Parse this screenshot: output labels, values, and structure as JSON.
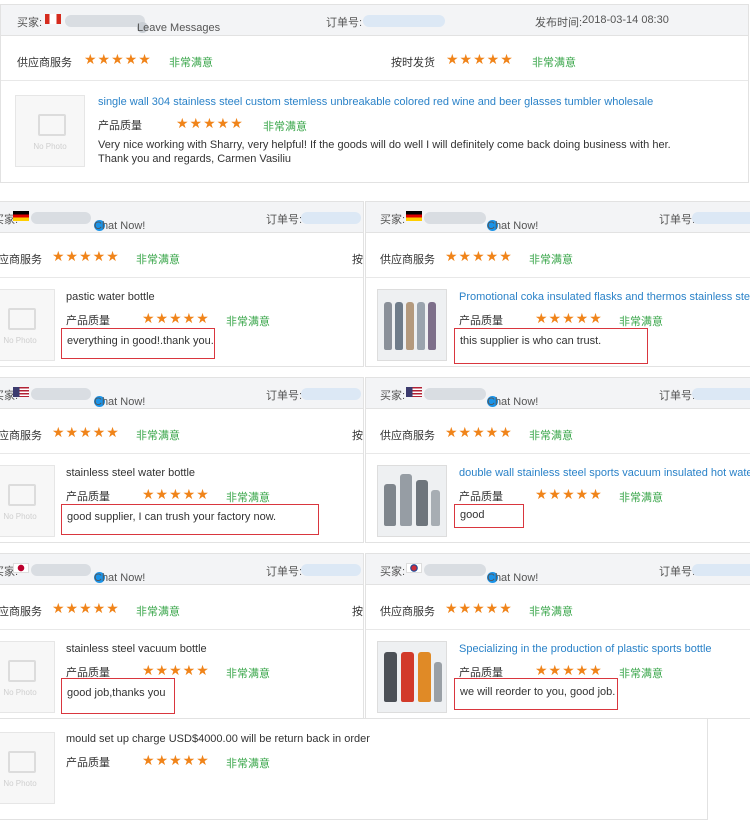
{
  "labels": {
    "buyer": "买家:",
    "order": "订单号:",
    "publish": "发布时间:",
    "supplier_service": "供应商服务",
    "on_time": "按时发货",
    "on_time_cut": "按",
    "product_quality": "产品质量",
    "very_satisfied": "非常满意",
    "leave_messages": "Leave Messages",
    "chat_now": "Chat Now!",
    "no_photo": "No Photo",
    "stars": "★★★★★"
  },
  "top_review": {
    "date": "2018-03-14 08:30",
    "product": "single wall 304 stainless steel custom stemless unbreakable colored red wine and beer glasses tumbler wholesale",
    "text": "Very nice working with Sharry, very helpful! If the goods will do well I will definitely come back doing business with her. Thank you and regards, Carmen Vasiliu"
  },
  "reviews": {
    "l1": {
      "product": "pastic water bottle",
      "text": "everything in good!.thank you."
    },
    "r1": {
      "product": "Promotional coka insulated flasks and thermos stainless steel v",
      "text": "this supplier is who can trust."
    },
    "l2": {
      "product": "stainless steel water bottle",
      "text": "good supplier, I can trush your factory now."
    },
    "r2": {
      "product": "double wall stainless steel sports vacuum insulated hot water fl",
      "text": "good"
    },
    "l3": {
      "product": "stainless steel vacuum bottle",
      "text": "good job,thanks you"
    },
    "r3": {
      "product": "Specializing in the production of plastic sports bottle",
      "text": "we will reorder to you, good job."
    },
    "l4": {
      "product": "mould set up charge USD$4000.00 will be return back in order"
    }
  },
  "colors": {
    "star": "#f0841a",
    "satisfied": "#39a64a",
    "link": "#2a82c8",
    "highlight": "#d9363e"
  }
}
